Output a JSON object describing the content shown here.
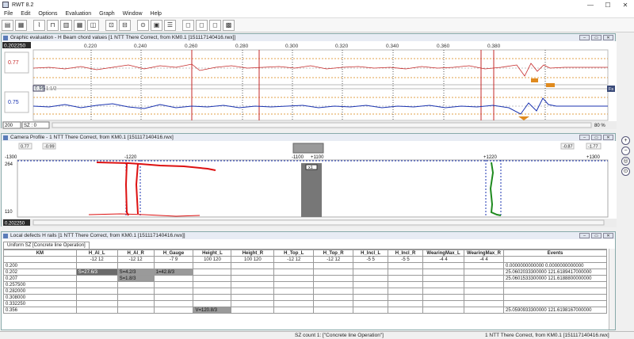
{
  "app": {
    "title": "RWT 8.2",
    "window_controls": [
      "—",
      "☐",
      "✕"
    ]
  },
  "menu": [
    "File",
    "Edit",
    "Options",
    "Evaluation",
    "Graph",
    "Window",
    "Help"
  ],
  "graphic_window": {
    "title": "Graphic evaluation - H Beam chord values [1 NTT There Correct, from KM0.1 [151117140416.rwx]]",
    "km_value": "0.202250",
    "ticks": [
      "0.220",
      "0.240",
      "0.260",
      "0.280",
      "0.300",
      "0.320",
      "0.340",
      "0.360",
      "0.380"
    ],
    "upper_label": "0.77",
    "lower_label": "0.75",
    "mid_value": "0.96",
    "mid_ratio": "1:1/2",
    "side_badge": "Fs",
    "scale_select": "200",
    "sz_label": "SZ : 0",
    "zoom": "80 %"
  },
  "cross_window": {
    "title": "Camera Profile - 1 NTT There Correct, from KM0.1 [151117140416.rwx]",
    "left_values": [
      "0.77",
      "-0.99"
    ],
    "right_values": [
      "-0.87",
      "-1.77"
    ],
    "top_labels": [
      "-1300",
      "-1220",
      "-1100",
      "+1100",
      "+1220",
      "+1300"
    ],
    "y_top": "264",
    "y_bottom": "110",
    "center_box": "x1",
    "km_value": "0.202250"
  },
  "defects_window": {
    "title": "Local defects H rails [1 NTT There Correct, from KM0.1 [151117140416.rwx]]",
    "tab": "Uniform SZ [Concrete line Operation]",
    "columns": [
      "KM",
      "H_Al_L",
      "H_Al_R",
      "H_Gauge",
      "Height_L",
      "Height_R",
      "H_Top_L",
      "H_Top_R",
      "H_Incl_L",
      "H_Incl_R",
      "WearingMax_L",
      "WearingMax_R",
      "Events"
    ],
    "limits": [
      "",
      "-12 12",
      "-12 12",
      "-7 9",
      "100 120",
      "100 120",
      "-12 12",
      "-12 12",
      "-5 5",
      "-5 5",
      "-4 4",
      "-4 4",
      ""
    ],
    "rows": [
      [
        "0.200",
        "",
        "",
        "",
        "",
        "",
        "",
        "",
        "",
        "",
        "",
        "",
        "0.0000000000000 0.0000000000000"
      ],
      [
        "0.202",
        "S=27.6/3",
        "S=4.2/3",
        "1=42.8/3",
        "",
        "",
        "",
        "",
        "",
        "",
        "",
        "",
        "25.0602033300000 121.6189417000000"
      ],
      [
        "0.207",
        "",
        "S=1.8/3",
        "",
        "",
        "",
        "",
        "",
        "",
        "",
        "",
        "",
        "25.0601533300000 121.6188800000000"
      ],
      [
        "0.257500",
        "",
        "",
        "",
        "",
        "",
        "",
        "",
        "",
        "",
        "",
        "",
        ""
      ],
      [
        "0.282000",
        "",
        "",
        "",
        "",
        "",
        "",
        "",
        "",
        "",
        "",
        "",
        ""
      ],
      [
        "0.308000",
        "",
        "",
        "",
        "",
        "",
        "",
        "",
        "",
        "",
        "",
        "",
        ""
      ],
      [
        "0.332250",
        "",
        "",
        "",
        "",
        "",
        "",
        "",
        "",
        "",
        "",
        "",
        ""
      ],
      [
        "0.356",
        "",
        "",
        "",
        "V=120.8/3",
        "",
        "",
        "",
        "",
        "",
        "",
        "",
        "25.0590933300000 121.6198167000000"
      ]
    ]
  },
  "status": {
    "sz_count": "SZ count 1: [\"Concrete line Operation\"]",
    "file": "1 NTT There Correct, from KM0.1 [151117140416.rwx]"
  },
  "colors": {
    "accent": "#c62828",
    "blue_trace": "#1a33b0",
    "green_trace": "#1e8a1e",
    "orange": "#e08a1e"
  }
}
